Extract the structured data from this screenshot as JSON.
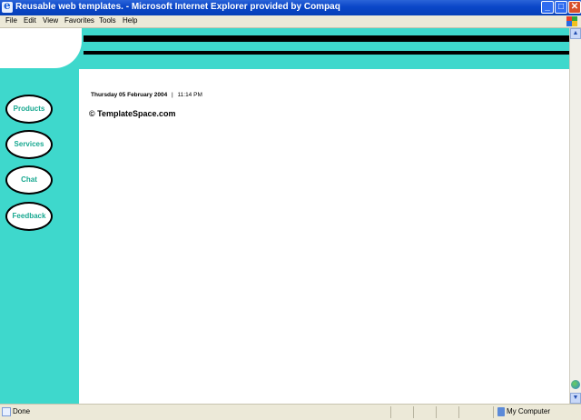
{
  "window": {
    "title": "Reusable web templates. - Microsoft Internet Explorer provided by Compaq",
    "buttons": {
      "minimize": "_",
      "maximize": "□",
      "close": "✕"
    }
  },
  "menu": [
    "File",
    "Edit",
    "View",
    "Favorites",
    "Tools",
    "Help"
  ],
  "page": {
    "nav": [
      "Products",
      "Services",
      "Chat",
      "Feedback"
    ],
    "date": "Thursday 05 February 2004",
    "separator": "|",
    "time": "11:14 PM",
    "copyright": "© TemplateSpace.com"
  },
  "scrollbar": {
    "up": "▲",
    "down": "▼"
  },
  "status": {
    "text": "Done",
    "zone": "My Computer"
  },
  "colors": {
    "accent_teal": "#3ed8cc",
    "nav_text": "#18a890",
    "titlebar_blue": "#0a46c8"
  }
}
